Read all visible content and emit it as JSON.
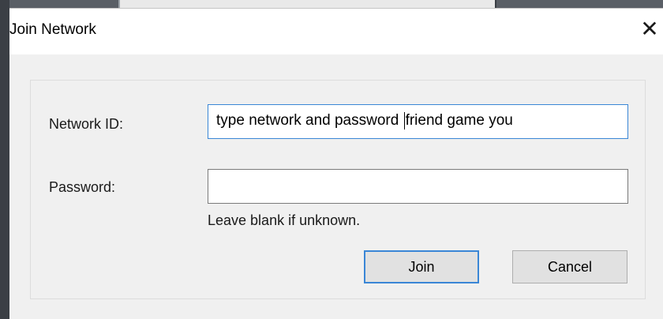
{
  "dialog": {
    "title": "Join Network",
    "close_glyph": "✕"
  },
  "form": {
    "network_id_label": "Network ID:",
    "network_id_value_before_caret": "type network and password",
    "network_id_value_after_caret": "friend game you",
    "password_label": "Password:",
    "password_value": "",
    "password_hint": "Leave blank if unknown."
  },
  "buttons": {
    "join_label": "Join",
    "cancel_label": "Cancel"
  },
  "colors": {
    "focus_accent": "#3a86d6",
    "dialog_background": "#f0f0f0",
    "button_face": "#e1e1e1"
  }
}
